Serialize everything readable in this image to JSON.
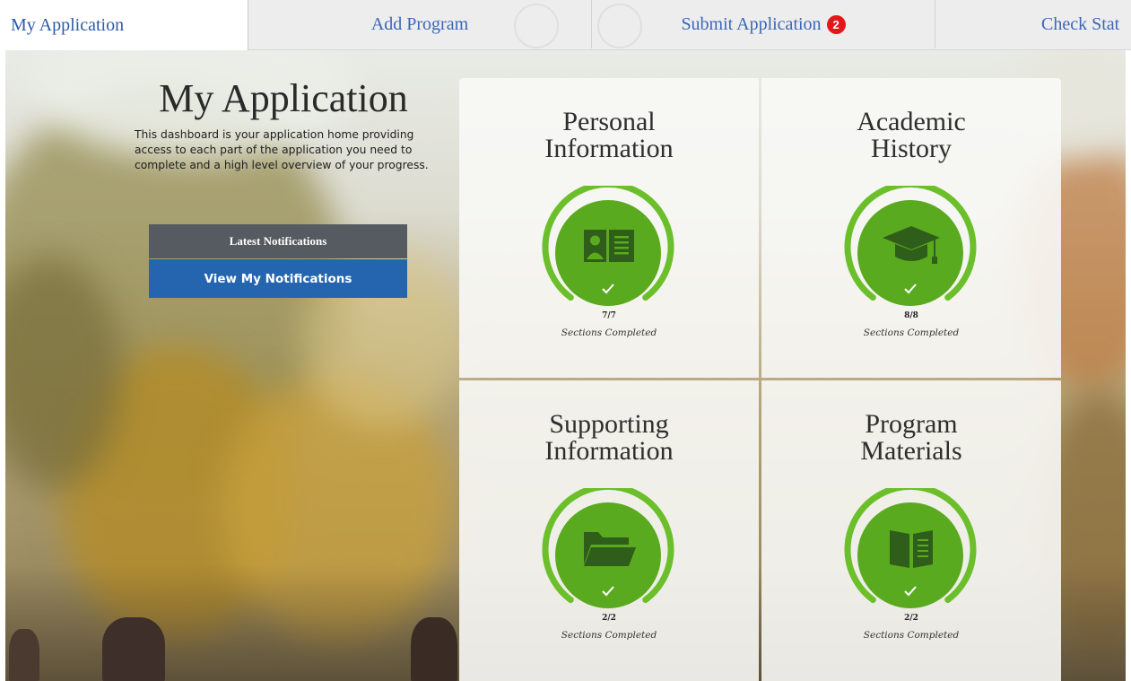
{
  "tabs": [
    {
      "label": "My Application",
      "active": true
    },
    {
      "label": "Add Program",
      "active": false
    },
    {
      "label": "Submit Application",
      "active": false,
      "badge": "2"
    },
    {
      "label": "Check Stat",
      "active": false
    }
  ],
  "intro": {
    "title": "My Application",
    "description": "This dashboard is your application home providing access to each part of the application you need to complete and a high level overview of your progress."
  },
  "notifications": {
    "header": "Latest Notifications",
    "button_label": "View My Notifications"
  },
  "cards": [
    {
      "title_line1": "Personal",
      "title_line2": "Information",
      "icon": "id-card-icon",
      "count": "7/7",
      "label": "Sections Completed",
      "progress": 1.0
    },
    {
      "title_line1": "Academic",
      "title_line2": "History",
      "icon": "graduation-cap-icon",
      "count": "8/8",
      "label": "Sections Completed",
      "progress": 1.0
    },
    {
      "title_line1": "Supporting",
      "title_line2": "Information",
      "icon": "folder-icon",
      "count": "2/2",
      "label": "Sections Completed",
      "progress": 1.0
    },
    {
      "title_line1": "Program",
      "title_line2": "Materials",
      "icon": "book-icon",
      "count": "2/2",
      "label": "Sections Completed",
      "progress": 1.0
    }
  ],
  "colors": {
    "accent_green": "#5aaa1f",
    "ring_green": "#6bbf2a",
    "notification_blue": "#2565b0",
    "notification_header_gray": "#555b60",
    "tab_text_blue": "#3b66b8",
    "badge_red": "#e3161b"
  }
}
